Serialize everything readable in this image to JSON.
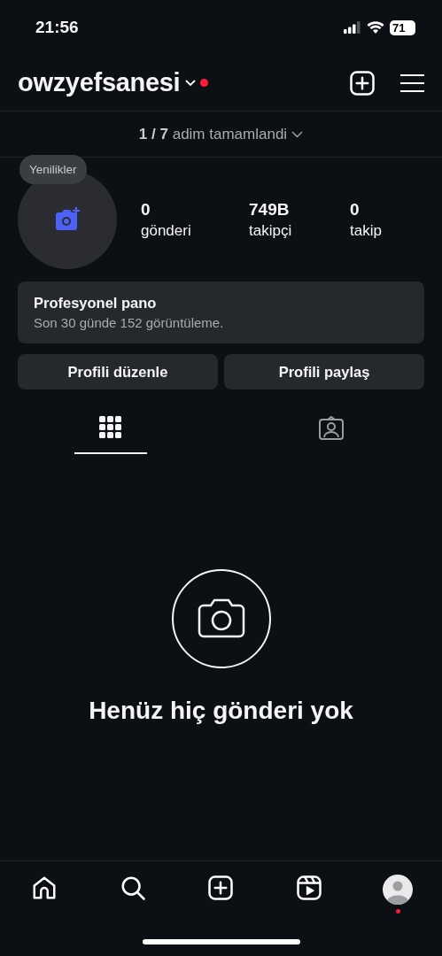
{
  "status_bar": {
    "time": "21:56",
    "battery": "71"
  },
  "header": {
    "username": "owzyefsanesi",
    "notification_dot": true
  },
  "progress": {
    "count": "1 / 7",
    "label": "adim tamamlandi"
  },
  "profile": {
    "tooltip": "Yenilikler",
    "stats": [
      {
        "value": "0",
        "label": "gönderi"
      },
      {
        "value": "749B",
        "label": "takipçi"
      },
      {
        "value": "0",
        "label": "takip"
      }
    ]
  },
  "dashboard": {
    "title": "Profesyonel pano",
    "subtitle": "Son 30 günde 152 görüntüleme."
  },
  "buttons": [
    "Profili düzenle",
    "Profili paylaş"
  ],
  "tabs": [
    {
      "kind": "grid",
      "selected": true
    },
    {
      "kind": "tagged",
      "selected": false
    }
  ],
  "empty_state": {
    "message": "Henüz hiç gönderi yok"
  },
  "bottom_nav": [
    {
      "kind": "home",
      "badge": false
    },
    {
      "kind": "search",
      "badge": false
    },
    {
      "kind": "create",
      "badge": false
    },
    {
      "kind": "reels",
      "badge": false
    },
    {
      "kind": "profile",
      "badge": true
    }
  ]
}
